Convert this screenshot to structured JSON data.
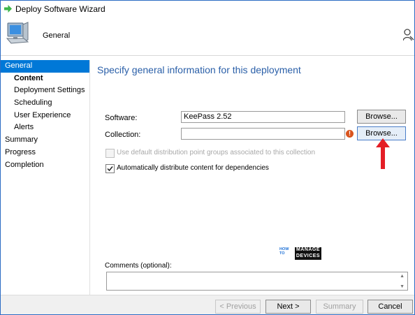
{
  "window": {
    "title": "Deploy Software Wizard"
  },
  "header": {
    "title": "General"
  },
  "sidebar": {
    "items": [
      {
        "label": "General",
        "active": true
      },
      {
        "label": "Content",
        "sub": true,
        "bold": true
      },
      {
        "label": "Deployment Settings",
        "sub": true
      },
      {
        "label": "Scheduling",
        "sub": true
      },
      {
        "label": "User Experience",
        "sub": true
      },
      {
        "label": "Alerts",
        "sub": true
      },
      {
        "label": "Summary"
      },
      {
        "label": "Progress"
      },
      {
        "label": "Completion"
      }
    ]
  },
  "main": {
    "heading": "Specify general information for this deployment",
    "software_label": "Software:",
    "software_value": "KeePass 2.52",
    "collection_label": "Collection:",
    "collection_value": "",
    "browse_label": "Browse...",
    "default_dp_label": "Use default distribution point groups associated to this collection",
    "auto_distribute_label": "Automatically distribute content for dependencies",
    "comments_label": "Comments (optional):",
    "comments_value": "",
    "logo_left": [
      "HOW",
      "TO"
    ],
    "logo_right": [
      "MANAGE",
      "DEVICES"
    ]
  },
  "buttons": {
    "previous": "< Previous",
    "next": "Next >",
    "summary": "Summary",
    "cancel": "Cancel"
  },
  "colors": {
    "accent": "#0078d7",
    "heading": "#2a5fa8",
    "annotation_arrow": "#e41e26"
  }
}
